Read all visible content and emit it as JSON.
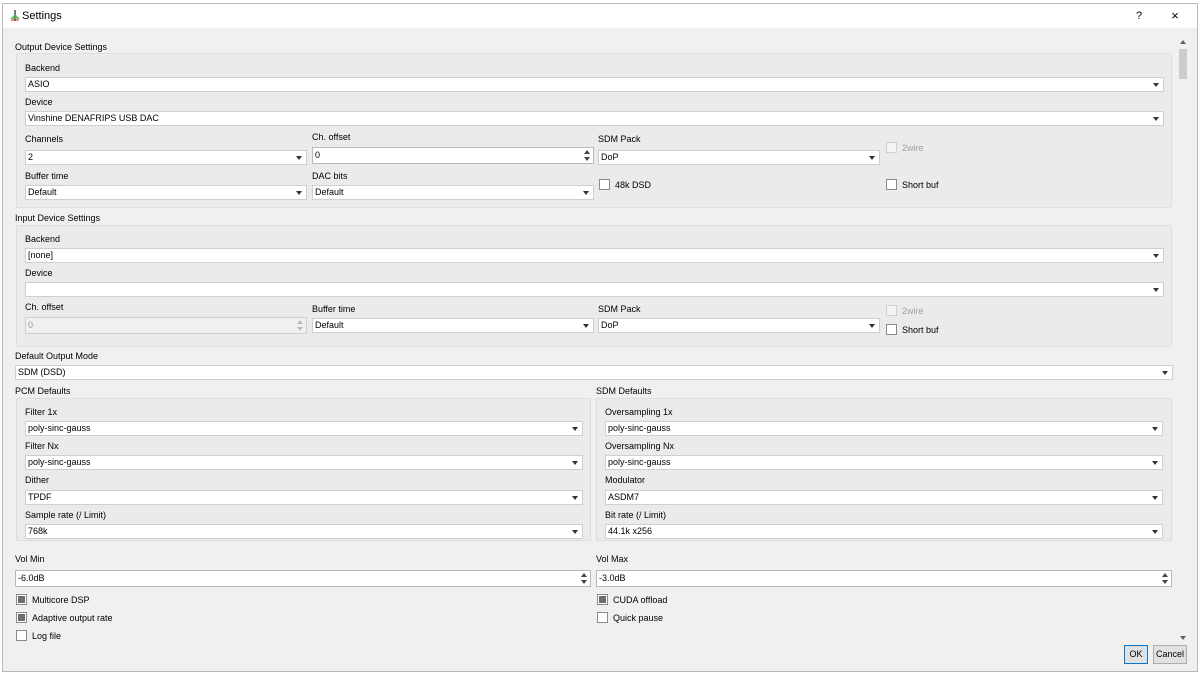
{
  "window": {
    "title": "Settings",
    "help": "?",
    "close": "×"
  },
  "output": {
    "group_title": "Output Device Settings",
    "backend_label": "Backend",
    "backend_value": "ASIO",
    "device_label": "Device",
    "device_value": "Vinshine DENAFRIPS USB DAC",
    "channels_label": "Channels",
    "channels_value": "2",
    "choffset_label": "Ch. offset",
    "choffset_value": "0",
    "sdmpack_label": "SDM Pack",
    "sdmpack_value": "DoP",
    "twowire_label": "2wire",
    "buffer_label": "Buffer time",
    "buffer_value": "Default",
    "dacbits_label": "DAC bits",
    "dacbits_value": "Default",
    "dsd48k_label": "48k DSD",
    "shortbuf_label": "Short buf"
  },
  "input": {
    "group_title": "Input Device Settings",
    "backend_label": "Backend",
    "backend_value": "[none]",
    "device_label": "Device",
    "device_value": "",
    "choffset_label": "Ch. offset",
    "choffset_value": "0",
    "buffer_label": "Buffer time",
    "buffer_value": "Default",
    "sdmpack_label": "SDM Pack",
    "sdmpack_value": "DoP",
    "twowire_label": "2wire",
    "shortbuf_label": "Short buf"
  },
  "default_mode": {
    "label": "Default Output Mode",
    "value": "SDM (DSD)"
  },
  "pcm": {
    "group_title": "PCM Defaults",
    "filter1x_label": "Filter 1x",
    "filter1x_value": "poly-sinc-gauss",
    "filternx_label": "Filter Nx",
    "filternx_value": "poly-sinc-gauss",
    "dither_label": "Dither",
    "dither_value": "TPDF",
    "rate_label": "Sample rate (/ Limit)",
    "rate_value": "768k"
  },
  "sdm": {
    "group_title": "SDM Defaults",
    "os1x_label": "Oversampling 1x",
    "os1x_value": "poly-sinc-gauss",
    "osnx_label": "Oversampling Nx",
    "osnx_value": "poly-sinc-gauss",
    "modulator_label": "Modulator",
    "modulator_value": "ASDM7",
    "bitrate_label": "Bit rate (/ Limit)",
    "bitrate_value": "44.1k x256"
  },
  "volume": {
    "min_label": "Vol Min",
    "min_value": "-6.0dB",
    "max_label": "Vol Max",
    "max_value": "-3.0dB"
  },
  "options": {
    "multicore_label": "Multicore DSP",
    "cuda_label": "CUDA offload",
    "adaptive_label": "Adaptive output rate",
    "quickpause_label": "Quick pause",
    "logfile_label": "Log file"
  },
  "buttons": {
    "ok": "OK",
    "cancel": "Cancel"
  }
}
